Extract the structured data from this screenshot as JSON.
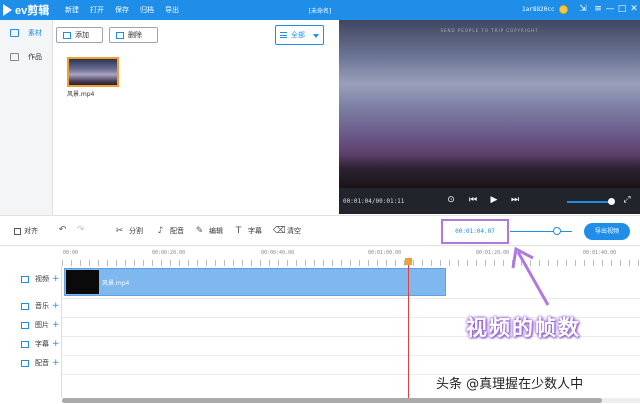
{
  "app": {
    "logo_text": "ev剪辑",
    "document_title": "[未命名]",
    "username": "1ar8820cc",
    "menu": [
      "新建",
      "打开",
      "保存",
      "归档",
      "导出"
    ],
    "window_controls": {
      "skin": "⇲",
      "menu": "≡",
      "minimize": "—",
      "maximize": "□",
      "close": "✕"
    }
  },
  "sidebar": {
    "items": [
      {
        "label": "素材",
        "icon": "grid-icon",
        "active": true
      },
      {
        "label": "作品",
        "icon": "folder-icon",
        "active": false
      }
    ]
  },
  "library": {
    "add_label": "添加",
    "delete_label": "删除",
    "filter_value": "全部",
    "media": [
      {
        "name": "风景.mp4"
      }
    ]
  },
  "preview": {
    "caption": "SEND PEOPLE TO TRIP COPYRIGHT",
    "timecode": "00:01:04/00:01:11",
    "volume": 0.9
  },
  "toolbar": {
    "snap_label": "对齐",
    "split_label": "分割",
    "voiceover_label": "配音",
    "edit_label": "编辑",
    "subtitle_label": "字幕",
    "clear_label": "清空",
    "frame_readout": "00:01:04.07",
    "zoom": 0.7,
    "export_label": "导出视频"
  },
  "timeline": {
    "tick_labels": [
      "00:00",
      "00:00:20.00",
      "00:00:40.00",
      "00:01:00.00",
      "00:01:20.00",
      "00:01:40.00"
    ],
    "tracks": [
      {
        "label": "视频",
        "icon": "video-icon"
      },
      {
        "label": "音乐",
        "icon": "music-icon"
      },
      {
        "label": "图片",
        "icon": "image-icon"
      },
      {
        "label": "字幕",
        "icon": "text-icon"
      },
      {
        "label": "配音",
        "icon": "mic-icon"
      }
    ],
    "clip_label": "风景.mp4"
  },
  "annotation": {
    "text": "视频的帧数",
    "color": "#9a64d6"
  },
  "watermark": "头条 @真理握在少数人中",
  "colors": {
    "accent": "#1e8ee9",
    "highlight": "#b079e0",
    "playhead": "#e04040",
    "clip": "#7fb8ee"
  }
}
